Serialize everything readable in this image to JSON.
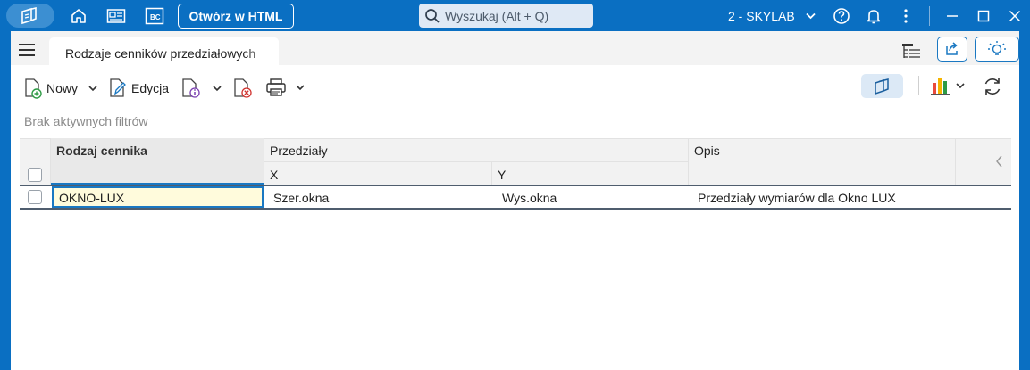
{
  "titlebar": {
    "html_button": "Otwórz w HTML",
    "search_placeholder": "Wyszukaj (Alt + Q)",
    "database": "2 - SKYLAB",
    "bc_label": "BC"
  },
  "tab": {
    "label": "Rodzaje cenników przedziałowych"
  },
  "toolbar": {
    "new_label": "Nowy",
    "edit_label": "Edycja"
  },
  "filter_status": "Brak aktywnych filtrów",
  "table": {
    "col_rodzaj": "Rodzaj cennika",
    "col_przedzialy": "Przedziały",
    "sub_x": "X",
    "sub_y": "Y",
    "col_opis": "Opis",
    "rows": [
      {
        "rodzaj": "OKNO-LUX",
        "x": "Szer.okna",
        "y": "Wys.okna",
        "opis": "Przedziały wymiarów dla Okno LUX"
      }
    ]
  },
  "colors": {
    "titlebar": "#0a6fc2",
    "accent": "#1a78c2",
    "selected_cell": "#fffbdc"
  }
}
